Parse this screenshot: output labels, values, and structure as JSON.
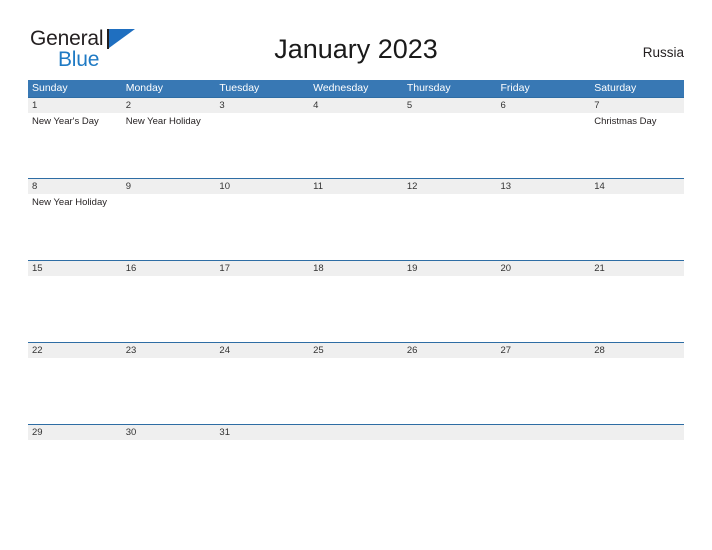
{
  "brand": {
    "name_top": "General",
    "name_bottom": "Blue",
    "flag_icon": "flag-triangle-icon",
    "color_dark": "#231f20",
    "color_blue": "#1f7ac4"
  },
  "header": {
    "title": "January 2023",
    "country": "Russia"
  },
  "theme": {
    "header_blue": "#3878b4",
    "row_divider_blue": "#2e6da4",
    "date_band_gray": "#efefef",
    "text_dark": "#231f20"
  },
  "calendar": {
    "day_names": [
      "Sunday",
      "Monday",
      "Tuesday",
      "Wednesday",
      "Thursday",
      "Friday",
      "Saturday"
    ],
    "weeks": [
      {
        "dates": [
          "1",
          "2",
          "3",
          "4",
          "5",
          "6",
          "7"
        ],
        "events": [
          "New Year's Day",
          "New Year Holiday",
          "",
          "",
          "",
          "",
          "Christmas Day"
        ]
      },
      {
        "dates": [
          "8",
          "9",
          "10",
          "11",
          "12",
          "13",
          "14"
        ],
        "events": [
          "New Year Holiday",
          "",
          "",
          "",
          "",
          "",
          ""
        ]
      },
      {
        "dates": [
          "15",
          "16",
          "17",
          "18",
          "19",
          "20",
          "21"
        ],
        "events": [
          "",
          "",
          "",
          "",
          "",
          "",
          ""
        ]
      },
      {
        "dates": [
          "22",
          "23",
          "24",
          "25",
          "26",
          "27",
          "28"
        ],
        "events": [
          "",
          "",
          "",
          "",
          "",
          "",
          ""
        ]
      },
      {
        "dates": [
          "29",
          "30",
          "31",
          "",
          "",
          "",
          ""
        ],
        "events": [
          "",
          "",
          "",
          "",
          "",
          "",
          ""
        ]
      }
    ]
  }
}
